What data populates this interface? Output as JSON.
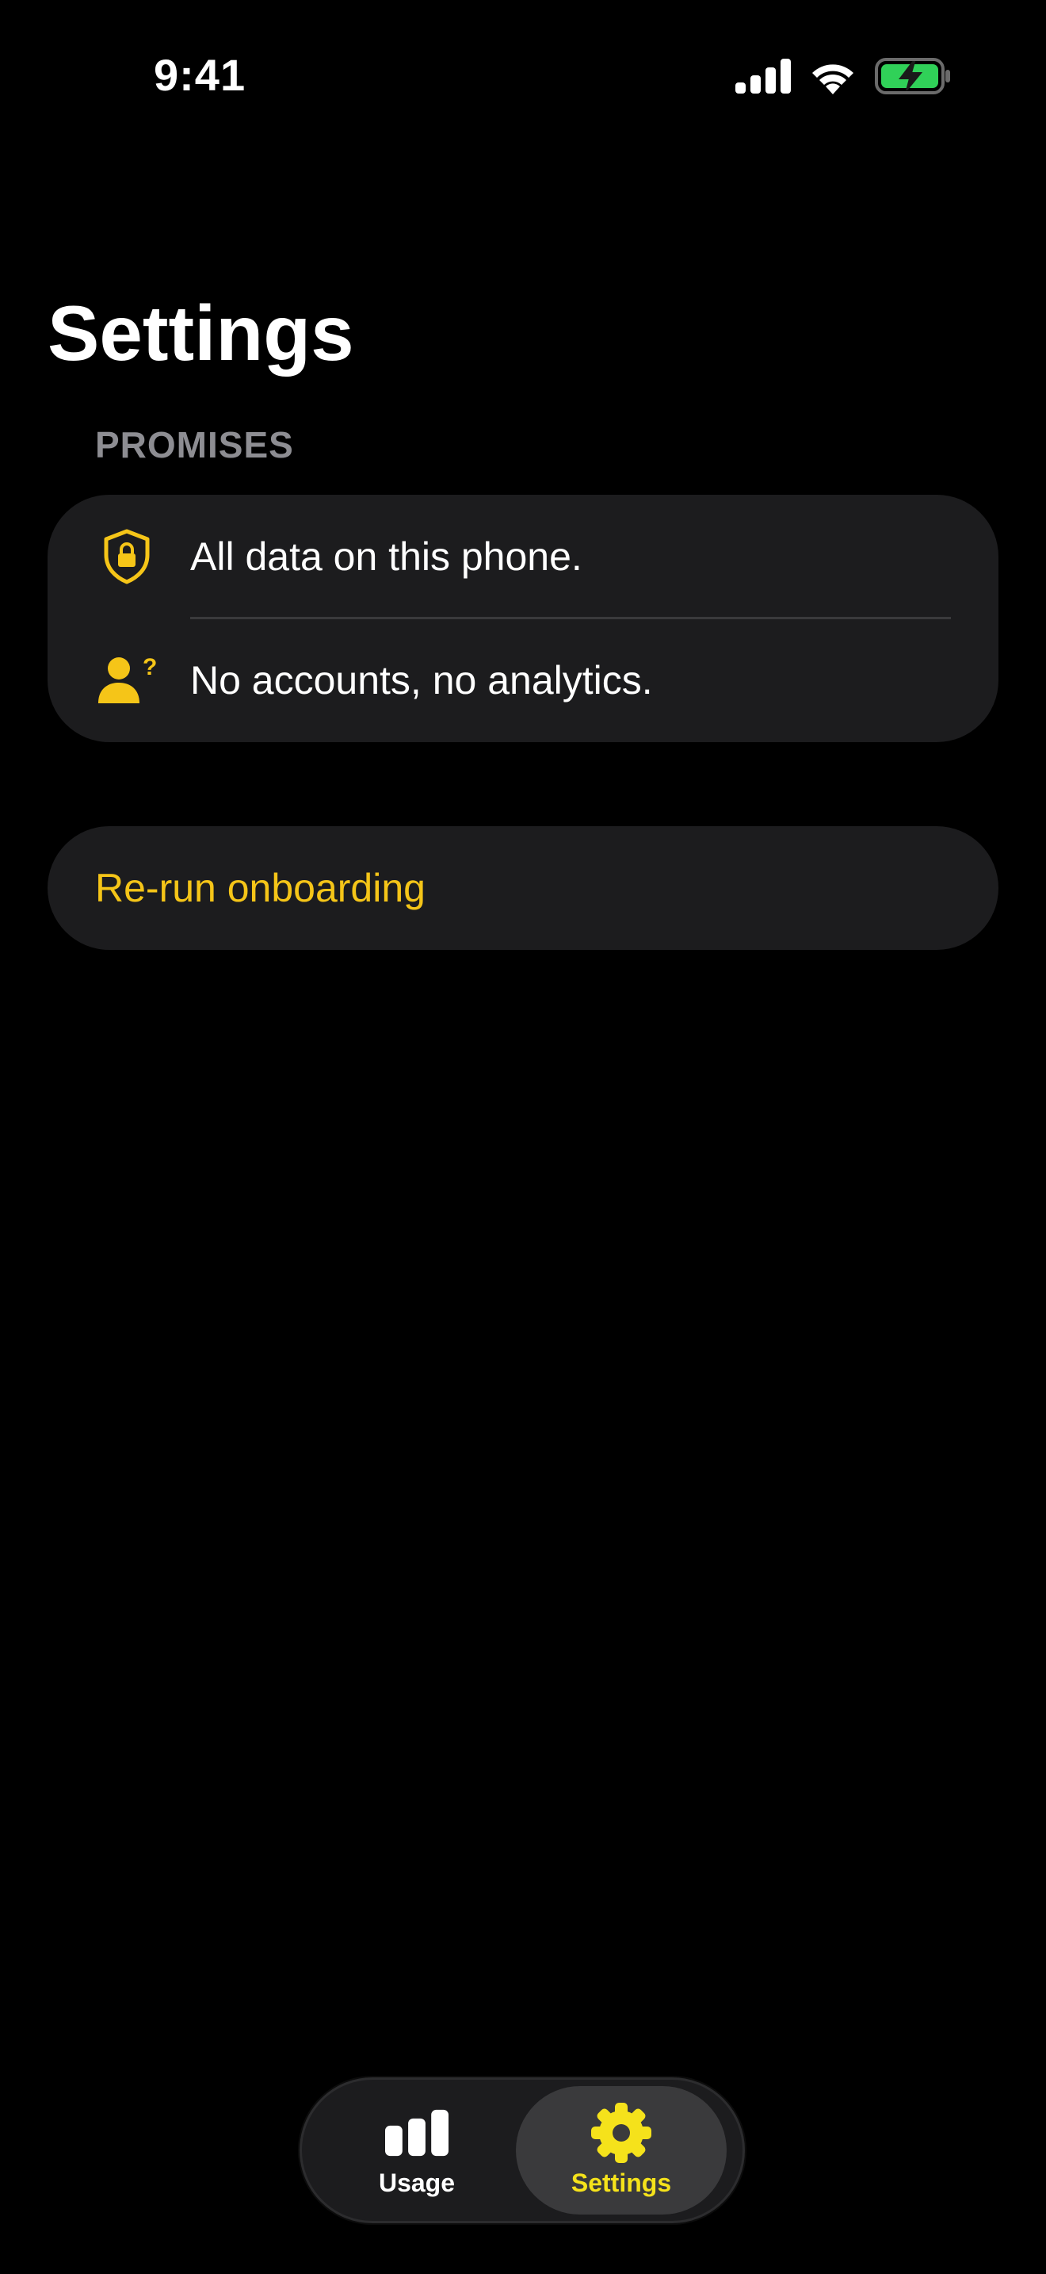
{
  "status_bar": {
    "time": "9:41",
    "icons": [
      "cellular-signal-icon",
      "wifi-icon",
      "battery-charging-icon"
    ]
  },
  "page": {
    "title": "Settings"
  },
  "promises": {
    "header": "PROMISES",
    "items": [
      {
        "icon": "shield-lock-icon",
        "label": "All data on this phone."
      },
      {
        "icon": "person-question-icon",
        "label": "No accounts, no analytics."
      }
    ]
  },
  "actions": {
    "rerun_onboarding": "Re-run onboarding"
  },
  "tab_bar": {
    "tabs": [
      {
        "icon": "bar-chart-icon",
        "label": "Usage",
        "selected": false
      },
      {
        "icon": "gear-icon",
        "label": "Settings",
        "selected": true
      }
    ]
  },
  "colors": {
    "accent": "#f5c518",
    "tab_selected_label": "#f5e21b",
    "background": "#000000",
    "card": "#1c1c1e",
    "section_header": "#8d8d92",
    "battery": "#30d158"
  }
}
